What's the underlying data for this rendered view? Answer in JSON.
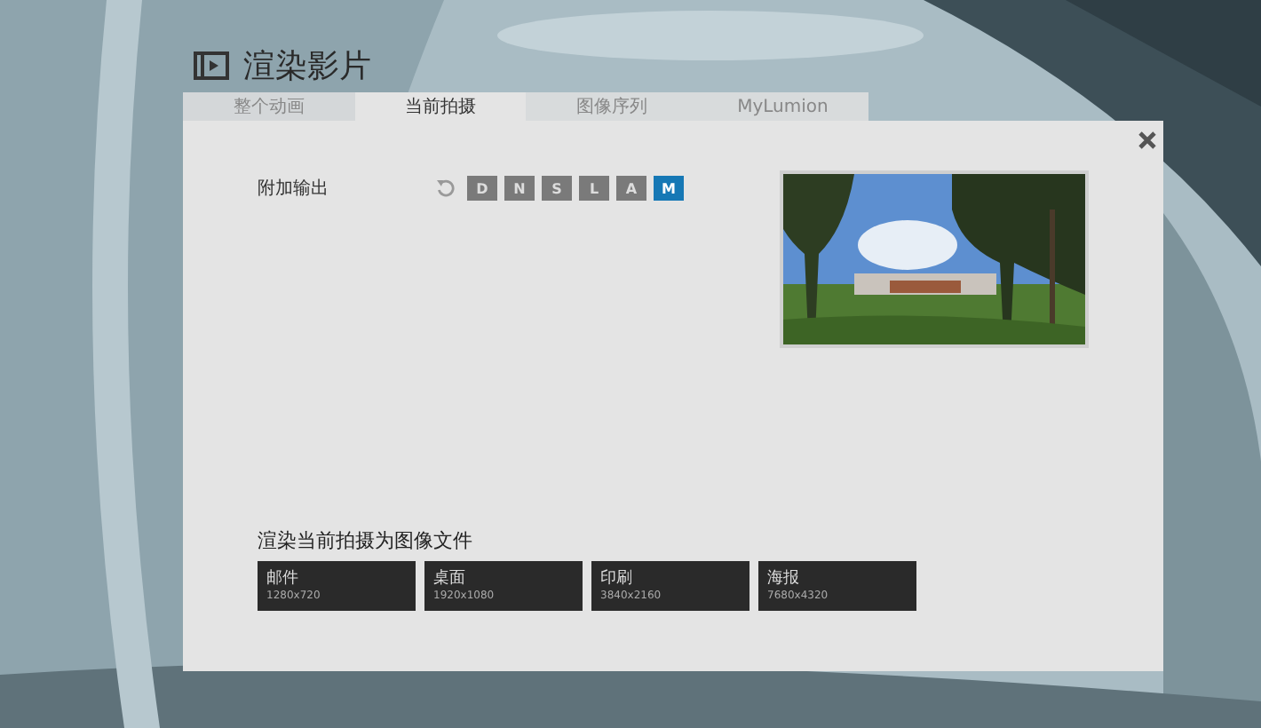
{
  "window": {
    "title": "渲染影片"
  },
  "tabs": [
    {
      "label": "整个动画",
      "selected": false
    },
    {
      "label": "当前拍摄",
      "selected": true
    },
    {
      "label": "图像序列",
      "selected": false
    },
    {
      "label": "MyLumion",
      "selected": false
    }
  ],
  "extra_output": {
    "label": "附加输出",
    "passes": [
      {
        "label": "D",
        "selected": false
      },
      {
        "label": "N",
        "selected": false
      },
      {
        "label": "S",
        "selected": false
      },
      {
        "label": "L",
        "selected": false
      },
      {
        "label": "A",
        "selected": false
      },
      {
        "label": "M",
        "selected": true
      }
    ]
  },
  "render": {
    "heading": "渲染当前拍摄为图像文件",
    "presets": [
      {
        "name": "邮件",
        "resolution": "1280x720"
      },
      {
        "name": "桌面",
        "resolution": "1920x1080"
      },
      {
        "name": "印刷",
        "resolution": "3840x2160"
      },
      {
        "name": "海报",
        "resolution": "7680x4320"
      }
    ]
  }
}
